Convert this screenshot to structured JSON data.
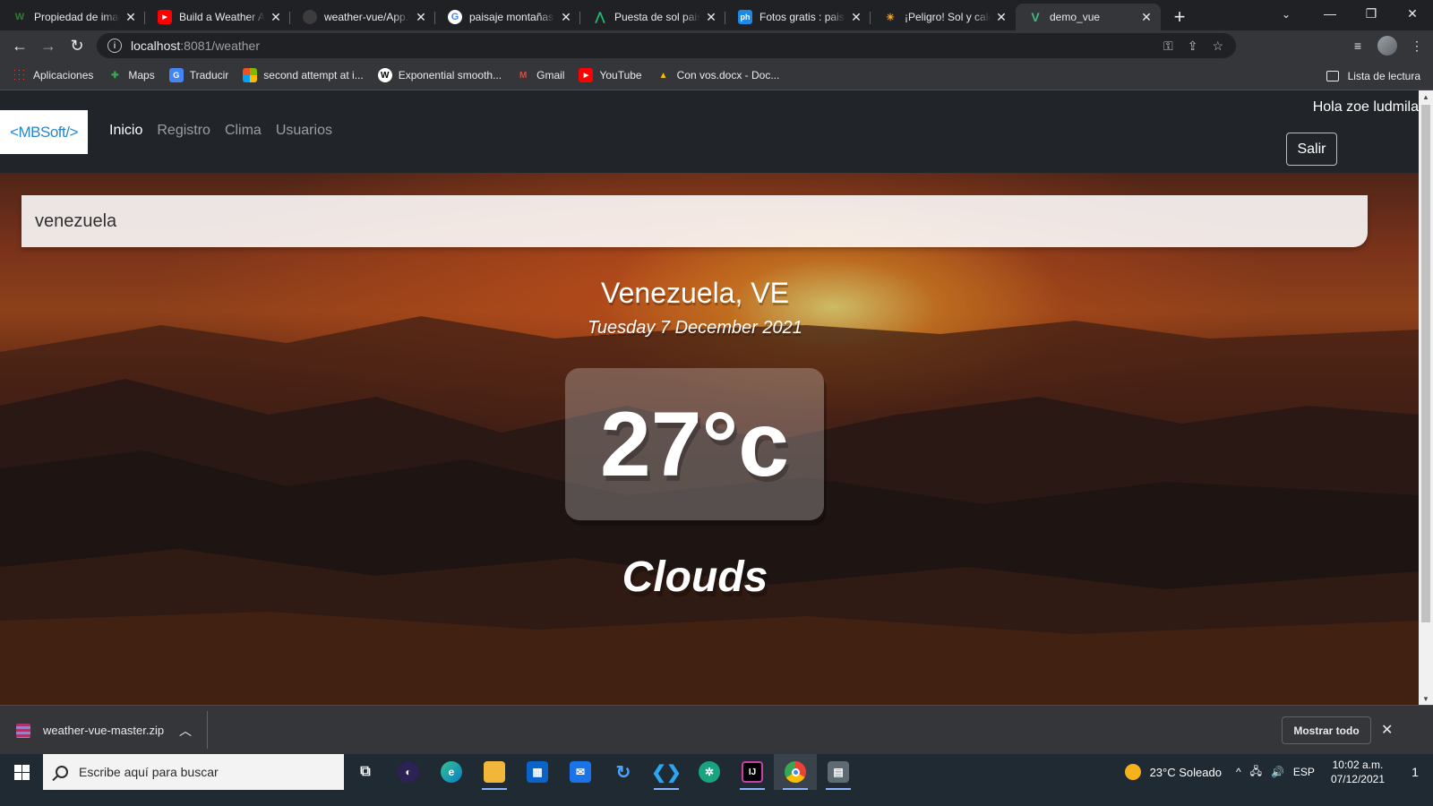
{
  "browser": {
    "tabs": [
      {
        "title": "Propiedad de imag",
        "favicon": "wikipedia-icon",
        "favicon_color": "#2e7d32"
      },
      {
        "title": "Build a Weather Ap",
        "favicon": "youtube-icon",
        "favicon_color": "#ff0000"
      },
      {
        "title": "weather-vue/App.v",
        "favicon": "github-icon",
        "favicon_color": "#e8eaed"
      },
      {
        "title": "paisaje montañas s",
        "favicon": "google-icon",
        "favicon_color": "#4285f4"
      },
      {
        "title": "Puesta de sol paisa",
        "favicon": "logo-icon",
        "favicon_color": "#1dbf73"
      },
      {
        "title": "Fotos gratis : paisa",
        "favicon": "ph-icon",
        "favicon_color": "#1e88e5"
      },
      {
        "title": "¡Peligro! Sol y calor",
        "favicon": "sun-icon",
        "favicon_color": "#f9a825"
      },
      {
        "title": "demo_vue",
        "favicon": "vue-icon",
        "favicon_color": "#41b883"
      }
    ],
    "url_host": "localhost",
    "url_rest": ":8081/weather",
    "bookmarks": [
      {
        "label": "Aplicaciones",
        "icon": "apps-icon",
        "color": "#ea4335"
      },
      {
        "label": "Maps",
        "icon": "maps-icon",
        "color": "#34a853"
      },
      {
        "label": "Traducir",
        "icon": "translate-icon",
        "color": "#4285f4"
      },
      {
        "label": "second attempt at i...",
        "icon": "microsoft-icon",
        "color": "#f25022"
      },
      {
        "label": "Exponential smooth...",
        "icon": "wikipedia-icon",
        "color": "#ffffff"
      },
      {
        "label": "Gmail",
        "icon": "gmail-icon",
        "color": "#ea4335"
      },
      {
        "label": "YouTube",
        "icon": "youtube-icon",
        "color": "#ff0000"
      },
      {
        "label": "Con vos.docx - Doc...",
        "icon": "drive-icon",
        "color": "#fbbc04"
      }
    ],
    "reading_list": "Lista de lectura"
  },
  "app": {
    "brand": "<MBSoft/>",
    "nav": [
      "Inicio",
      "Registro",
      "Clima",
      "Usuarios"
    ],
    "greeting": "Hola zoe ludmila",
    "logout": "Salir"
  },
  "weather": {
    "query": "venezuela",
    "location": "Venezuela, VE",
    "date": "Tuesday 7 December 2021",
    "temperature": "27°c",
    "condition": "Clouds"
  },
  "downloads": {
    "file": "weather-vue-master.zip",
    "show_all": "Mostrar todo"
  },
  "taskbar": {
    "search_placeholder": "Escribe aquí para buscar",
    "weather": "23°C  Soleado",
    "language": "ESP",
    "time": "10:02 a.m.",
    "date": "07/12/2021",
    "notifications": "1",
    "apps": [
      {
        "name": "task-view-icon",
        "color": "#1f2a33",
        "glyph": "▭"
      },
      {
        "name": "eclipse-icon",
        "color": "#2c2255",
        "glyph": "◉"
      },
      {
        "name": "edge-icon",
        "color": "#0a7cc7",
        "glyph": "e"
      },
      {
        "name": "file-explorer-icon",
        "color": "#f2b73a",
        "glyph": "▬"
      },
      {
        "name": "store-icon",
        "color": "#0a63c9",
        "glyph": "▦"
      },
      {
        "name": "mail-icon",
        "color": "#1a73e8",
        "glyph": "✉"
      },
      {
        "name": "refresh-app-icon",
        "color": "#1f2a33",
        "glyph": "↻"
      },
      {
        "name": "vscode-icon",
        "color": "#0078d7",
        "glyph": "❯"
      },
      {
        "name": "chatgpt-icon",
        "color": "#19a37f",
        "glyph": "✲"
      },
      {
        "name": "intellij-icon",
        "color": "#000000",
        "glyph": "IJ"
      },
      {
        "name": "chrome-icon",
        "color": "#1e8e3e",
        "glyph": "◎"
      },
      {
        "name": "remote-app-icon",
        "color": "#5f6b73",
        "glyph": "▤"
      }
    ]
  }
}
